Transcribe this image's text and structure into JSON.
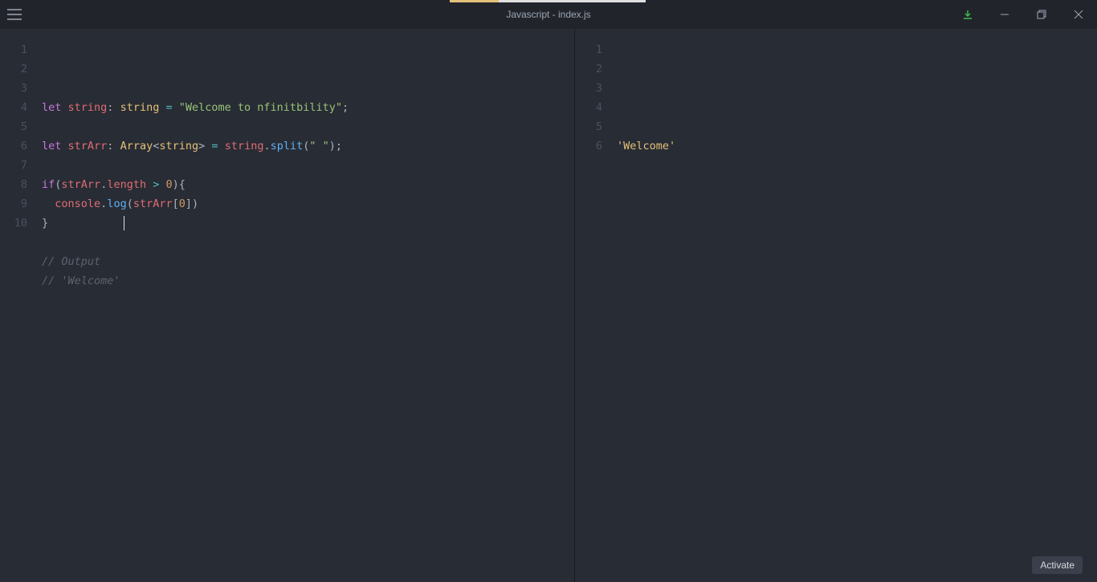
{
  "title": "Javascript - index.js",
  "activate_label": "Activate",
  "editor": {
    "lines": [
      {
        "n": "1",
        "tokens": [
          [
            "kw",
            "let "
          ],
          [
            "var",
            "string"
          ],
          [
            "punc",
            ": "
          ],
          [
            "type",
            "string"
          ],
          [
            "punc",
            " "
          ],
          [
            "op",
            "="
          ],
          [
            "punc",
            " "
          ],
          [
            "str",
            "\"Welcome to nfinitbility\""
          ],
          [
            "punc",
            ";"
          ]
        ]
      },
      {
        "n": "2",
        "tokens": []
      },
      {
        "n": "3",
        "tokens": [
          [
            "kw",
            "let "
          ],
          [
            "var",
            "strArr"
          ],
          [
            "punc",
            ": "
          ],
          [
            "type",
            "Array"
          ],
          [
            "punc",
            "<"
          ],
          [
            "type",
            "string"
          ],
          [
            "punc",
            ">"
          ],
          [
            "punc",
            " "
          ],
          [
            "op",
            "="
          ],
          [
            "punc",
            " "
          ],
          [
            "var",
            "string"
          ],
          [
            "punc",
            "."
          ],
          [
            "fn",
            "split"
          ],
          [
            "punc",
            "("
          ],
          [
            "str",
            "\" \""
          ],
          [
            "punc",
            ");"
          ]
        ]
      },
      {
        "n": "4",
        "tokens": []
      },
      {
        "n": "5",
        "tokens": [
          [
            "kw",
            "if"
          ],
          [
            "punc",
            "("
          ],
          [
            "var",
            "strArr"
          ],
          [
            "punc",
            "."
          ],
          [
            "prop",
            "length"
          ],
          [
            "punc",
            " "
          ],
          [
            "op",
            ">"
          ],
          [
            "punc",
            " "
          ],
          [
            "num",
            "0"
          ],
          [
            "punc",
            "){"
          ]
        ]
      },
      {
        "n": "6",
        "tokens": [
          [
            "punc",
            "  "
          ],
          [
            "var",
            "console"
          ],
          [
            "punc",
            "."
          ],
          [
            "fn",
            "log"
          ],
          [
            "punc",
            "("
          ],
          [
            "var",
            "strArr"
          ],
          [
            "punc",
            "["
          ],
          [
            "num",
            "0"
          ],
          [
            "punc",
            "])"
          ]
        ]
      },
      {
        "n": "7",
        "tokens": [
          [
            "punc",
            "}"
          ]
        ]
      },
      {
        "n": "8",
        "tokens": []
      },
      {
        "n": "9",
        "tokens": [
          [
            "cmt",
            "// Output"
          ]
        ]
      },
      {
        "n": "10",
        "tokens": [
          [
            "cmt",
            "// 'Welcome'"
          ]
        ]
      }
    ]
  },
  "output": {
    "lines": [
      {
        "n": "1",
        "tokens": []
      },
      {
        "n": "2",
        "tokens": []
      },
      {
        "n": "3",
        "tokens": []
      },
      {
        "n": "4",
        "tokens": []
      },
      {
        "n": "5",
        "tokens": []
      },
      {
        "n": "6",
        "tokens": [
          [
            "outstr",
            "'Welcome'"
          ]
        ]
      }
    ]
  }
}
